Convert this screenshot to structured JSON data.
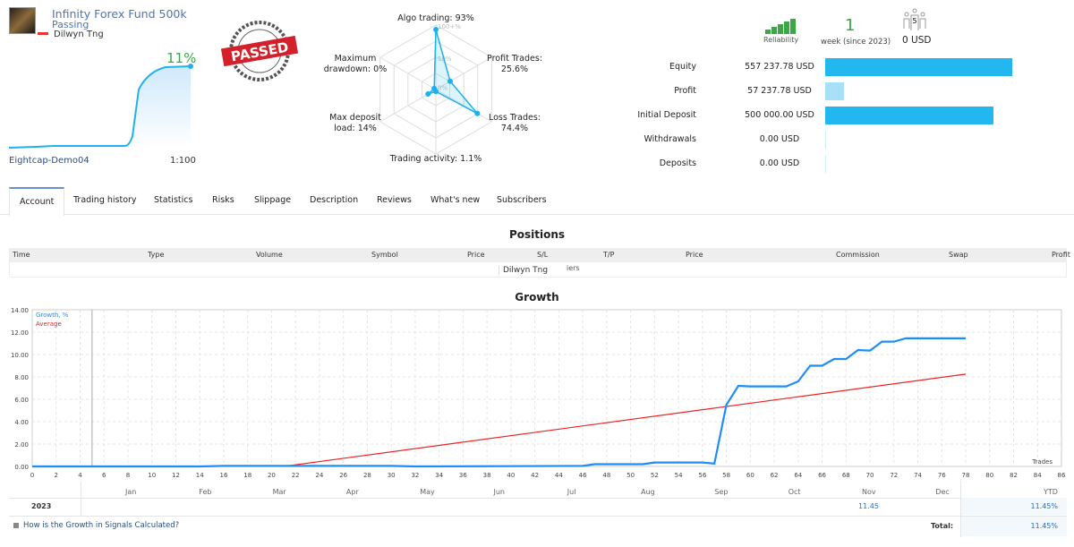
{
  "header": {
    "title": "Infinity Forex Fund 500k",
    "status": "Passing",
    "author": "Dilwyn Tng",
    "growth_pct": "11%",
    "server": "Eightcap-Demo04",
    "leverage": "1:100",
    "stamp_text": "PASSED"
  },
  "radar": {
    "grid_labels": [
      "100+%",
      "50%",
      "0%"
    ],
    "axes": [
      {
        "label": "Algo trading: 93%",
        "value": 93
      },
      {
        "label": "Profit Trades: 25.6%",
        "value": 25.6
      },
      {
        "label": "Loss Trades: 74.4%",
        "value": 74.4
      },
      {
        "label": "Trading activity: 1.1%",
        "value": 1.1
      },
      {
        "label": "Max deposit load: 14%",
        "value": 14
      },
      {
        "label": "Maximum drawdown: 0%",
        "value": 0
      }
    ],
    "color": "#1ab2ed"
  },
  "stats": {
    "reliability_label": "Reliability",
    "reliability_level": 5,
    "weeks": "1",
    "weeks_label": "week (since 2023)",
    "subscribers": "5",
    "subscribers_funds": "0 USD"
  },
  "finance": [
    {
      "label": "Equity",
      "value": "557 237.78 USD",
      "amount": 557237.78,
      "color": "#22b7ef"
    },
    {
      "label": "Profit",
      "value": "57 237.78 USD",
      "amount": 57237.78,
      "color": "#a8e0f7"
    },
    {
      "label": "Initial Deposit",
      "value": "500 000.00 USD",
      "amount": 500000,
      "color": "#22b7ef"
    },
    {
      "label": "Withdrawals",
      "value": "0.00 USD",
      "amount": 0,
      "color": "#22b7ef"
    },
    {
      "label": "Deposits",
      "value": "0.00 USD",
      "amount": 0,
      "color": "#22b7ef"
    }
  ],
  "tabs": [
    "Account",
    "Trading history",
    "Statistics",
    "Risks",
    "Slippage",
    "Description",
    "Reviews",
    "What's new",
    "Subscribers"
  ],
  "positions": {
    "title": "Positions",
    "columns": [
      "Time",
      "Type",
      "Volume",
      "Symbol",
      "Price",
      "S/L",
      "T/P",
      "Price",
      "Commission",
      "Swap",
      "Profit"
    ],
    "overlay_text": "Dilwyn Tng",
    "overlay_tail": "iers"
  },
  "growth": {
    "title": "Growth",
    "chart_data": {
      "type": "line",
      "xlabel": "Trades",
      "xlim": [
        0,
        86
      ],
      "ylim": [
        0,
        14
      ],
      "x_ticks": [
        0,
        2,
        4,
        6,
        8,
        10,
        12,
        14,
        16,
        18,
        20,
        22,
        24,
        26,
        28,
        30,
        32,
        34,
        36,
        38,
        40,
        42,
        44,
        46,
        48,
        50,
        52,
        54,
        56,
        58,
        60,
        62,
        64,
        66,
        68,
        70,
        72,
        74,
        76,
        78,
        80,
        82,
        84,
        86
      ],
      "y_ticks": [
        "0.00",
        "2.00",
        "4.00",
        "6.00",
        "8.00",
        "10.00",
        "12.00",
        "14.00"
      ],
      "grid": true,
      "legend": "top-left",
      "series": [
        {
          "name": "Growth, %",
          "color": "#1e8df5",
          "points": [
            [
              0,
              0
            ],
            [
              14,
              0
            ],
            [
              16,
              0.05
            ],
            [
              30,
              0.05
            ],
            [
              32,
              0
            ],
            [
              46,
              0.05
            ],
            [
              47,
              0.2
            ],
            [
              51,
              0.2
            ],
            [
              52,
              0.35
            ],
            [
              56,
              0.35
            ],
            [
              57,
              0.25
            ],
            [
              58,
              5.5
            ],
            [
              59,
              7.2
            ],
            [
              60,
              7.15
            ],
            [
              63,
              7.15
            ],
            [
              64,
              7.6
            ],
            [
              65,
              9.0
            ],
            [
              66,
              9.0
            ],
            [
              67,
              9.6
            ],
            [
              68,
              9.6
            ],
            [
              69,
              10.4
            ],
            [
              70,
              10.35
            ],
            [
              71,
              11.15
            ],
            [
              72,
              11.15
            ],
            [
              73,
              11.45
            ],
            [
              78,
              11.45
            ]
          ]
        },
        {
          "name": "Average",
          "color": "#ee2222",
          "points": [
            [
              21,
              0
            ],
            [
              78,
              8.25
            ]
          ]
        }
      ]
    },
    "months": [
      "Jan",
      "Feb",
      "Mar",
      "Apr",
      "May",
      "Jun",
      "Jul",
      "Aug",
      "Sep",
      "Oct",
      "Nov",
      "Dec"
    ],
    "ytd_label": "YTD",
    "year": "2023",
    "nov_value": "11.45",
    "ytd_value": "11.45%",
    "help_link": "How is the Growth in Signals Calculated?",
    "total_label": "Total:",
    "total_value": "11.45%"
  }
}
